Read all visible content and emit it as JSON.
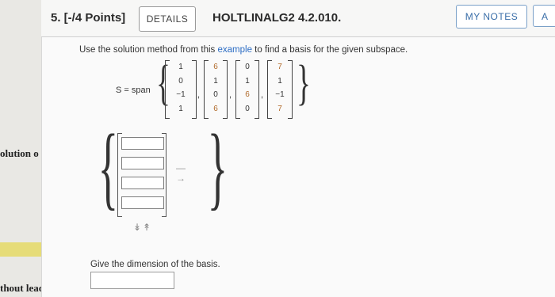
{
  "left_panel": {
    "snippet_1": "olution o",
    "snippet_2": "thout leadi"
  },
  "header": {
    "question_title": "5. [-/4 Points]",
    "details_label": "DETAILS",
    "problem_code": "HOLTLINALG2 4.2.010.",
    "mynotes_label": "MY NOTES",
    "a_label": "A"
  },
  "instructions": {
    "before": "Use the solution method from this ",
    "link": "example",
    "after": " to find a basis for the given subspace."
  },
  "subspace": {
    "label": "S = span",
    "vectors": [
      [
        "1",
        "0",
        "−1",
        "1"
      ],
      [
        "6",
        "1",
        "0",
        "6"
      ],
      [
        "0",
        "1",
        "6",
        "0"
      ],
      [
        "7",
        "1",
        "−1",
        "7"
      ]
    ]
  },
  "basis": {
    "hint_1": "—",
    "hint_2": "→",
    "reorder_arrows": "↡↟"
  },
  "dimension": {
    "label": "Give the dimension of the basis.",
    "value": ""
  },
  "colors": {
    "link": "#2b6cc4",
    "highlight": "#e6dc78"
  }
}
